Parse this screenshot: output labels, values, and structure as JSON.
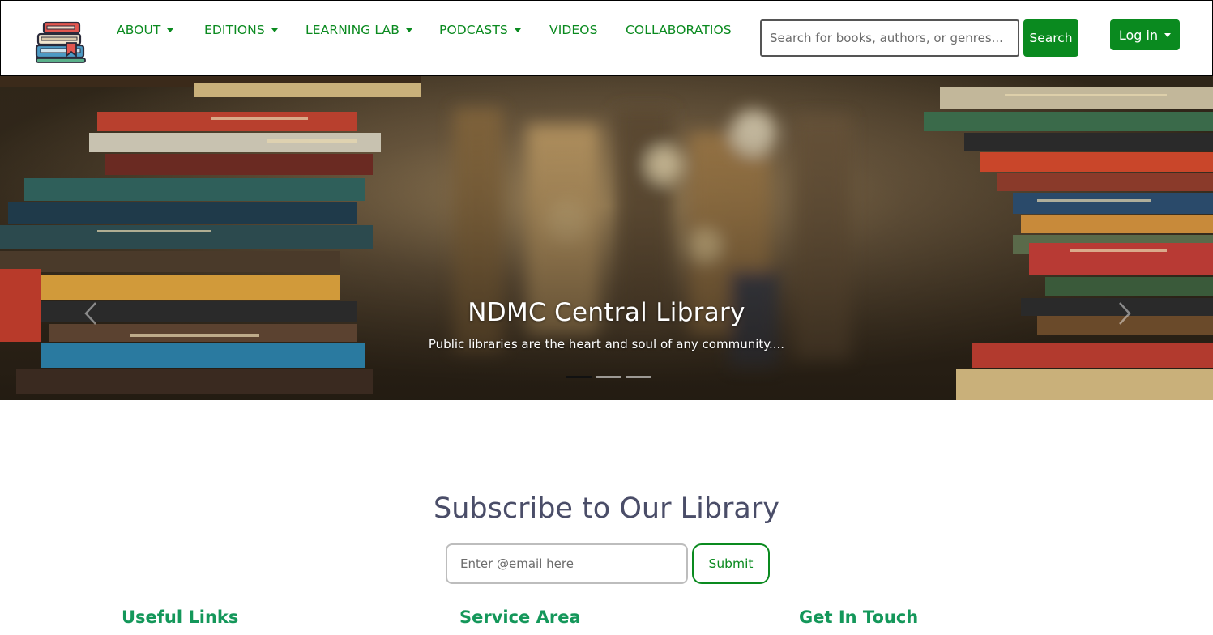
{
  "navbar": {
    "logo": {
      "icon": "book-stack-logo-icon"
    },
    "items": [
      {
        "label": "ABOUT",
        "dropdown": true
      },
      {
        "label": "EDITIONS",
        "dropdown": true
      },
      {
        "label": "LEARNING LAB",
        "dropdown": true
      },
      {
        "label": "PODCASTS",
        "dropdown": true
      },
      {
        "label": "VIDEOS",
        "dropdown": false
      },
      {
        "label": "COLLABORATIOS",
        "dropdown": false
      }
    ],
    "search": {
      "placeholder": "Search for books, authors, or genres...",
      "button_label": "Search"
    },
    "login": {
      "label": "Log in"
    }
  },
  "hero": {
    "title": "NDMC Central Library",
    "subtitle": "Public libraries are the heart and soul of any community....",
    "slides_count": 3,
    "active_slide": 1
  },
  "subscribe": {
    "title": "Subscribe to Our Library",
    "email_placeholder": "Enter @email here",
    "submit_label": "Submit"
  },
  "footer": {
    "headings": [
      "Useful Links",
      "Service Area",
      "Get In Touch"
    ]
  },
  "colors": {
    "brand_green": "#0a8a1f",
    "footer_heading": "#14975a",
    "subscribe_title": "#4a4d68"
  }
}
